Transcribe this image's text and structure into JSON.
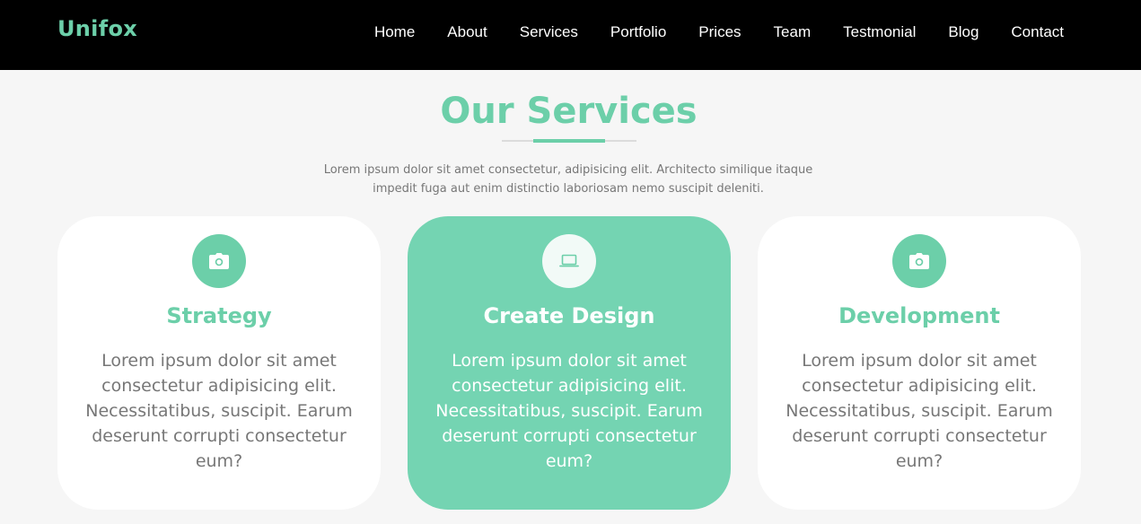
{
  "brand": {
    "name": "Unifox",
    "color": "#6ccfa9"
  },
  "nav": {
    "items": [
      {
        "label": "Home"
      },
      {
        "label": "About"
      },
      {
        "label": "Services"
      },
      {
        "label": "Portfolio"
      },
      {
        "label": "Prices"
      },
      {
        "label": "Team"
      },
      {
        "label": "Testmonial"
      },
      {
        "label": "Blog"
      },
      {
        "label": "Contact"
      }
    ]
  },
  "services": {
    "title": "Our Services",
    "description": "Lorem ipsum dolor sit amet consectetur, adipisicing elit. Architecto similique itaque impedit fuga aut enim distinctio laboriosam nemo suscipit deleniti.",
    "cards": [
      {
        "icon": "camera-icon",
        "title": "Strategy",
        "text": "Lorem ipsum dolor sit amet consectetur adipisicing elit. Necessitatibus, suscipit. Earum deserunt corrupti consectetur eum?",
        "active": false
      },
      {
        "icon": "laptop-icon",
        "title": "Create Design",
        "text": "Lorem ipsum dolor sit amet consectetur adipisicing elit. Necessitatibus, suscipit. Earum deserunt corrupti consectetur eum?",
        "active": true
      },
      {
        "icon": "camera-icon",
        "title": "Development",
        "text": "Lorem ipsum dolor sit amet consectetur adipisicing elit. Necessitatibus, suscipit. Earum deserunt corrupti consectetur eum?",
        "active": false
      }
    ]
  },
  "colors": {
    "accent": "#6ccfa9",
    "active_card": "#74d4b2",
    "navbar": "#000000",
    "background": "#f6f6f6",
    "body_text": "#777777"
  }
}
